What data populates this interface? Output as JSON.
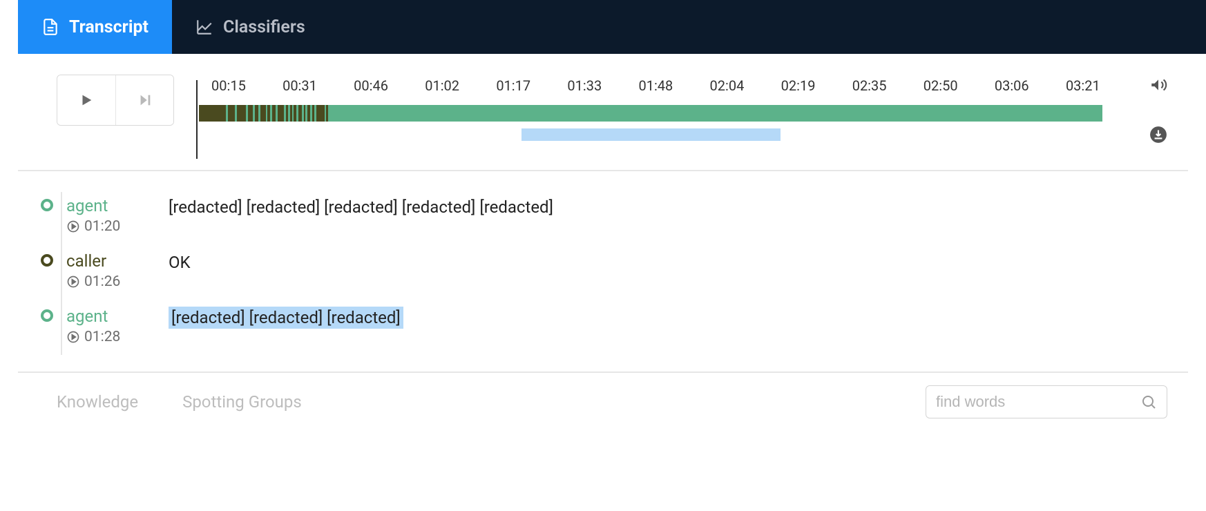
{
  "tabs": [
    {
      "label": "Transcript",
      "icon": "document-icon",
      "active": true
    },
    {
      "label": "Classifiers",
      "icon": "chart-icon",
      "active": false
    }
  ],
  "timeline": {
    "ticks": [
      "00:15",
      "00:31",
      "00:46",
      "01:02",
      "01:17",
      "01:33",
      "01:48",
      "02:04",
      "02:19",
      "02:35",
      "02:50",
      "03:06",
      "03:21"
    ],
    "dark_segments_pct": [
      [
        0,
        3
      ],
      [
        3.2,
        4
      ],
      [
        4.2,
        5.2
      ],
      [
        5.4,
        6
      ],
      [
        6.2,
        6.6
      ],
      [
        6.8,
        7.4
      ],
      [
        7.6,
        7.9
      ],
      [
        8.1,
        8.5
      ],
      [
        8.7,
        9.4
      ],
      [
        9.6,
        9.9
      ],
      [
        10.1,
        10.3
      ],
      [
        10.5,
        10.8
      ],
      [
        11,
        11.4
      ],
      [
        11.6,
        11.8
      ],
      [
        12,
        12.3
      ],
      [
        12.5,
        12.8
      ],
      [
        13,
        13.9
      ],
      [
        14.1,
        14.3
      ]
    ],
    "lower_hl_pct": [
      36,
      64.5
    ]
  },
  "side_icons": {
    "volume": "volume-icon",
    "download": "download-icon"
  },
  "entries": [
    {
      "speaker": "agent",
      "time": "01:20",
      "text": "[redacted] [redacted] [redacted] [redacted] [redacted]",
      "highlight": false
    },
    {
      "speaker": "caller",
      "time": "01:26",
      "text": "OK",
      "highlight": false
    },
    {
      "speaker": "agent",
      "time": "01:28",
      "text": "[redacted] [redacted] [redacted]",
      "highlight": true
    }
  ],
  "footer": {
    "links": [
      "Knowledge",
      "Spotting Groups"
    ],
    "search_placeholder": "find words"
  },
  "colors": {
    "accent": "#1d8cf8",
    "agent": "#5cb28a",
    "caller": "#4a4a1f",
    "highlight": "#b5d9f8"
  }
}
